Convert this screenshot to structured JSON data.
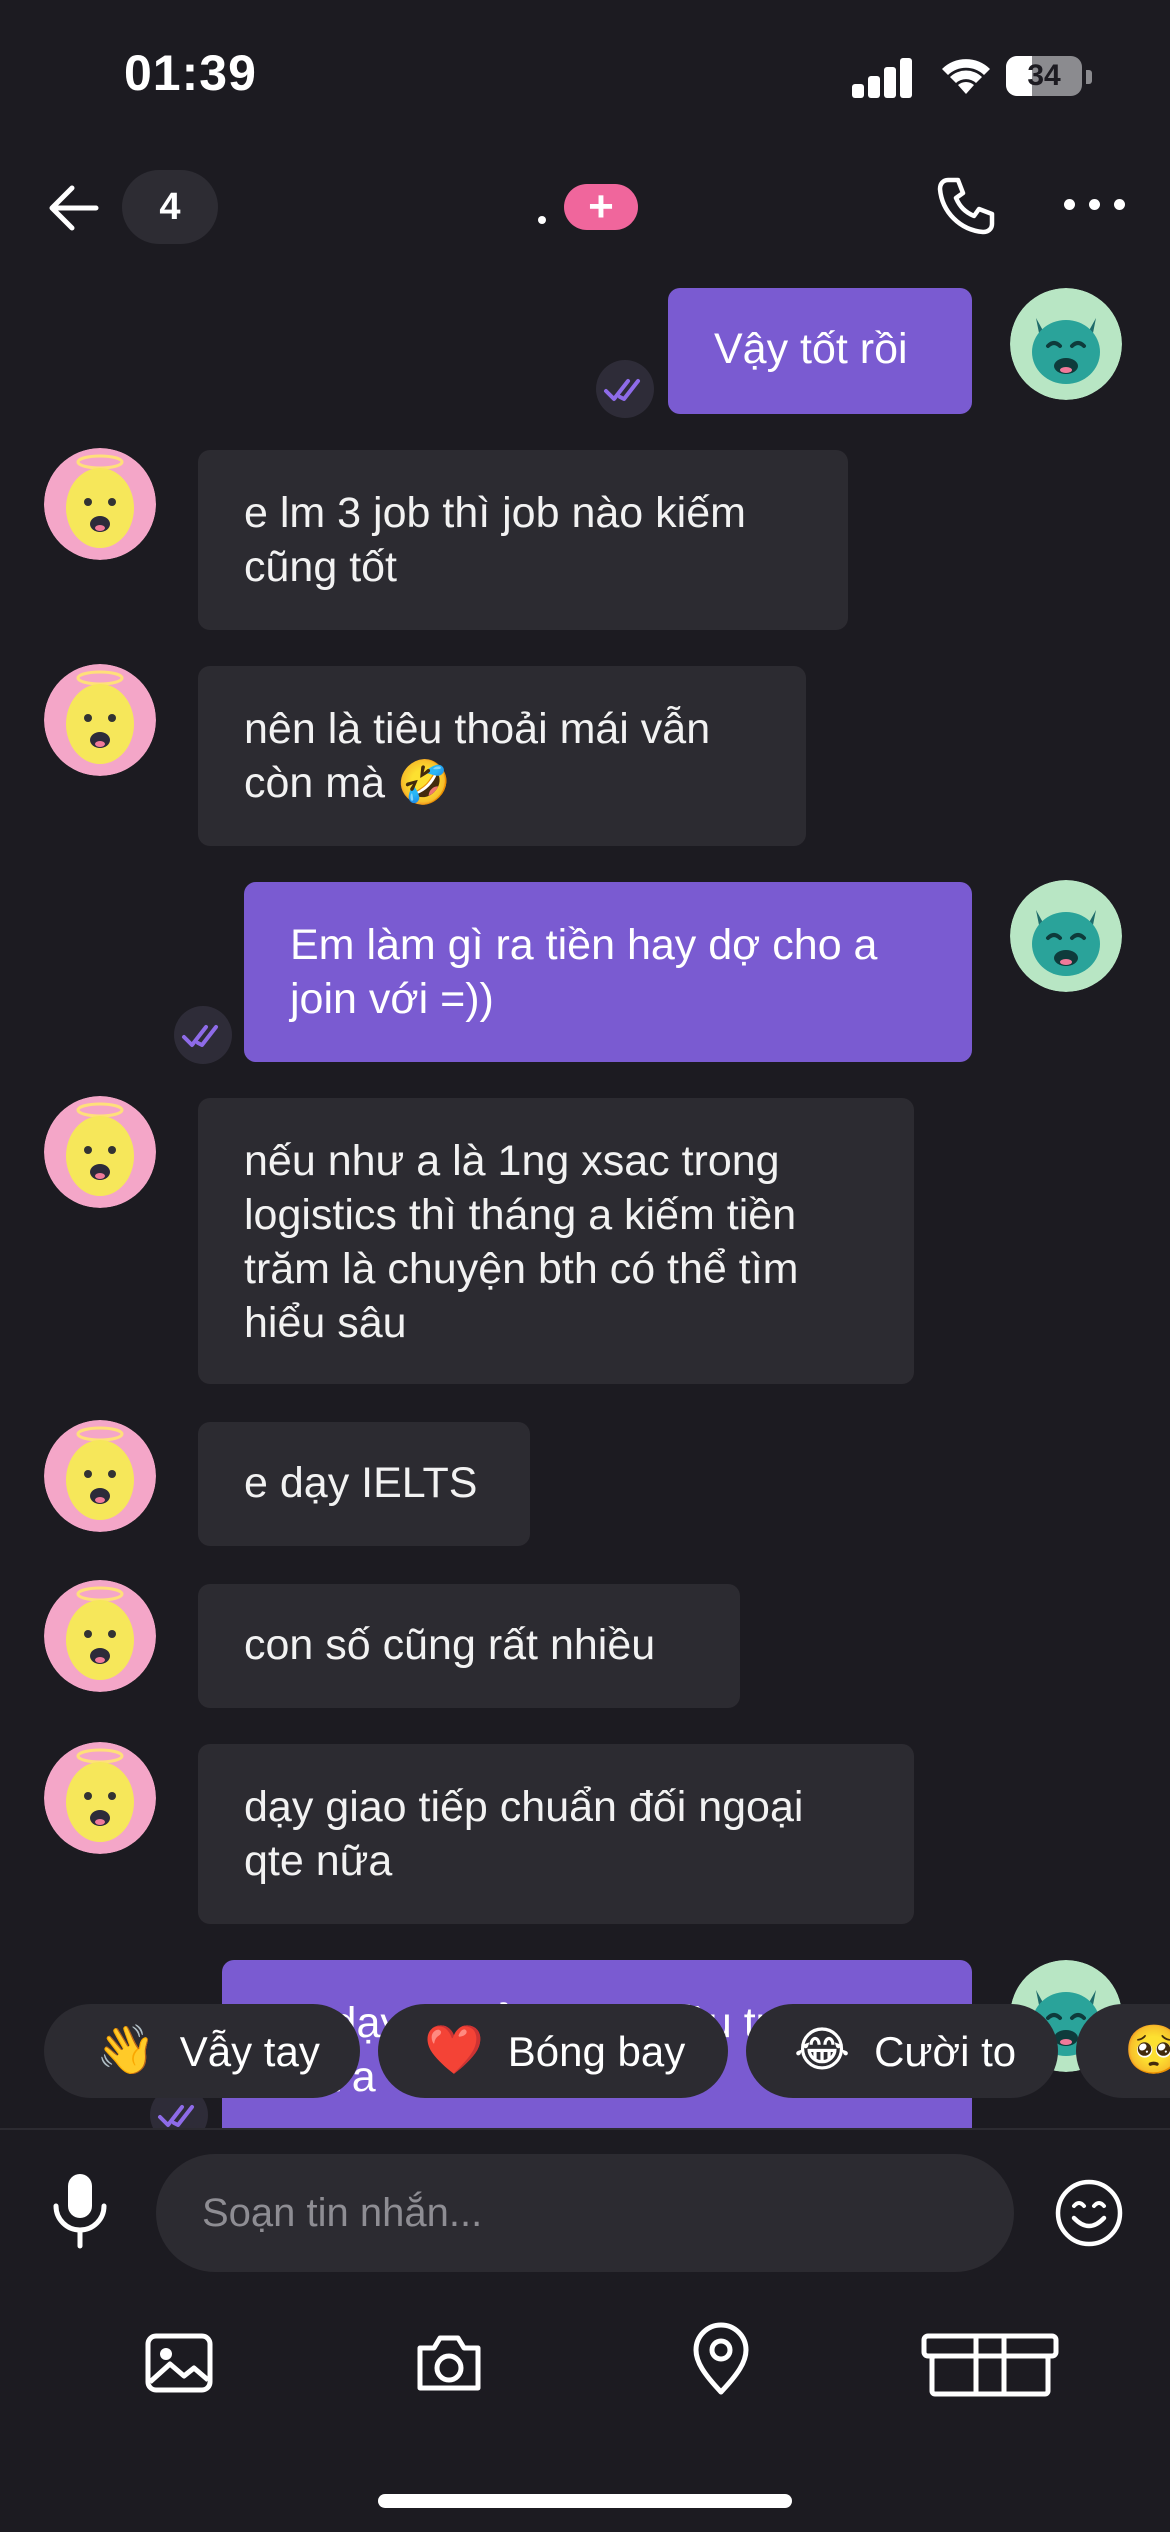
{
  "status_bar": {
    "time": "01:39",
    "battery": "34"
  },
  "header": {
    "unread_count": "4",
    "more_icon": "more-horizontal-icon",
    "call_icon": "phone-icon",
    "back_icon": "arrow-left-icon"
  },
  "messages": [
    {
      "side": "out",
      "text": "Vậy tốt rồi"
    },
    {
      "side": "in",
      "text": "e lm 3 job thì job nào kiếm cũng tốt"
    },
    {
      "side": "in",
      "text": "nên là tiêu thoải mái vẫn còn mà 🤣"
    },
    {
      "side": "out",
      "text": "Em làm gì ra tiền hay dợ cho a join với =))"
    },
    {
      "side": "in",
      "text": "nếu như a là 1ng xsac trong logistics thì tháng a kiếm tiền trăm là chuyện bth có thể tìm hiểu sâu"
    },
    {
      "side": "in",
      "text": "e dạy IELTS"
    },
    {
      "side": "in",
      "text": "con số cũng rất nhiều"
    },
    {
      "side": "in",
      "text": "dạy giao tiếp chuẩn đối ngoại qte nữa"
    },
    {
      "side": "out",
      "text": "Vô dạy gì để a có đi đầu tư thì nhà a"
    }
  ],
  "reactions": [
    {
      "emoji": "👋",
      "label": "Vẫy tay"
    },
    {
      "emoji": "❤️",
      "label": "Bóng bay"
    },
    {
      "emoji": "😂",
      "label": "Cười to"
    },
    {
      "emoji": "🥺",
      "label": ""
    }
  ],
  "composer": {
    "placeholder": "Soạn tin nhắn..."
  },
  "toolbar": {
    "icons": [
      "image-icon",
      "camera-icon",
      "location-pin-icon",
      "gift-icon"
    ]
  },
  "colors": {
    "background": "#1c1b21",
    "incoming_bubble": "#2c2b31",
    "outgoing_bubble": "#7a5bd1",
    "accent_pink": "#f0669c",
    "read_check": "#8e6be8"
  }
}
